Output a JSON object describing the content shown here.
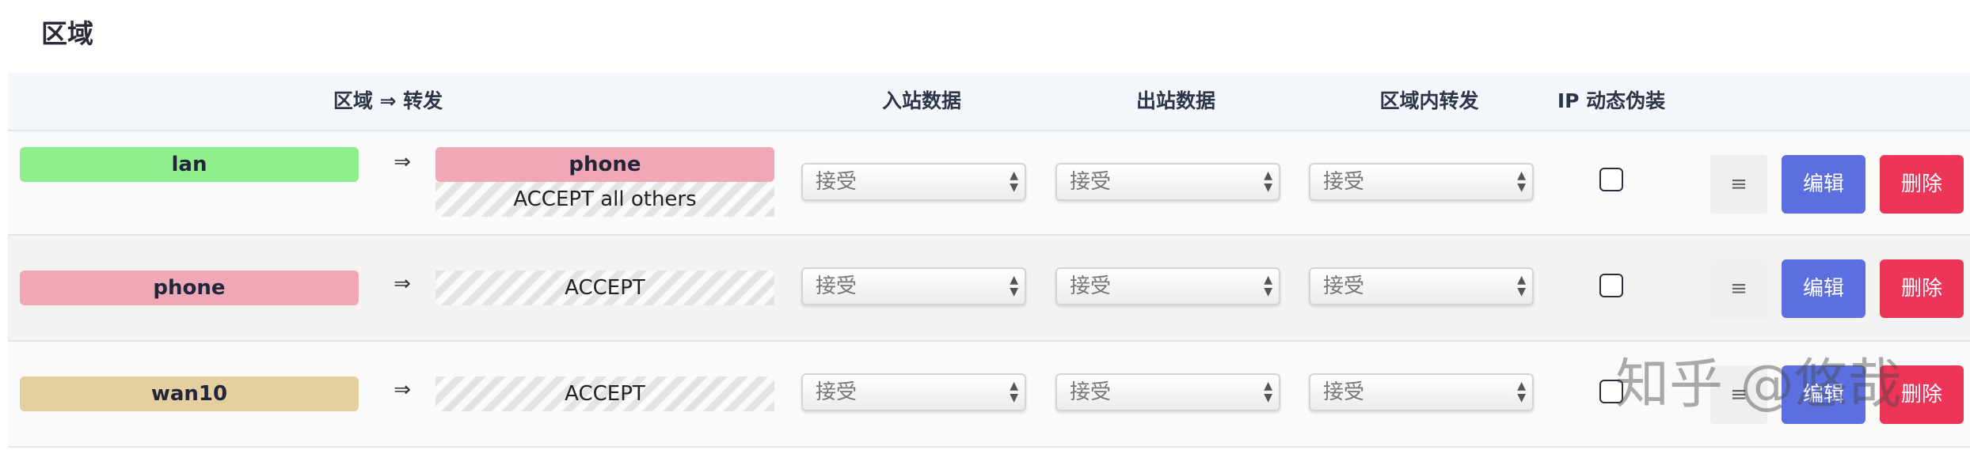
{
  "section": {
    "title": "区域"
  },
  "header": {
    "zone_forward": "区域 ⇒ 转发",
    "input": "入站数据",
    "output": "出站数据",
    "forward": "区域内转发",
    "masq": "IP 动态伪装"
  },
  "arrow_symbol": "⇒",
  "colors": {
    "lan": "#8fef8f",
    "phone": "#f0a8b6",
    "wan": "#e6cf9f",
    "edit_button": "#5b6fe0",
    "delete_button": "#ec3557"
  },
  "rows": [
    {
      "zone": "lan",
      "forward_dest": "phone",
      "forward_default": "ACCEPT all others",
      "input": "接受",
      "output": "接受",
      "forward": "接受",
      "masq": false,
      "more_label": "≡",
      "edit_label": "编辑",
      "delete_label": "删除"
    },
    {
      "zone": "phone",
      "forward_default": "ACCEPT",
      "input": "接受",
      "output": "接受",
      "forward": "接受",
      "masq": false,
      "more_label": "≡",
      "edit_label": "编辑",
      "delete_label": "删除"
    },
    {
      "zone": "wan10",
      "forward_default": "ACCEPT",
      "input": "接受",
      "output": "接受",
      "forward": "接受",
      "masq": false,
      "more_label": "≡",
      "edit_label": "编辑",
      "delete_label": "删除"
    }
  ],
  "watermark": "知乎 @悠哉"
}
